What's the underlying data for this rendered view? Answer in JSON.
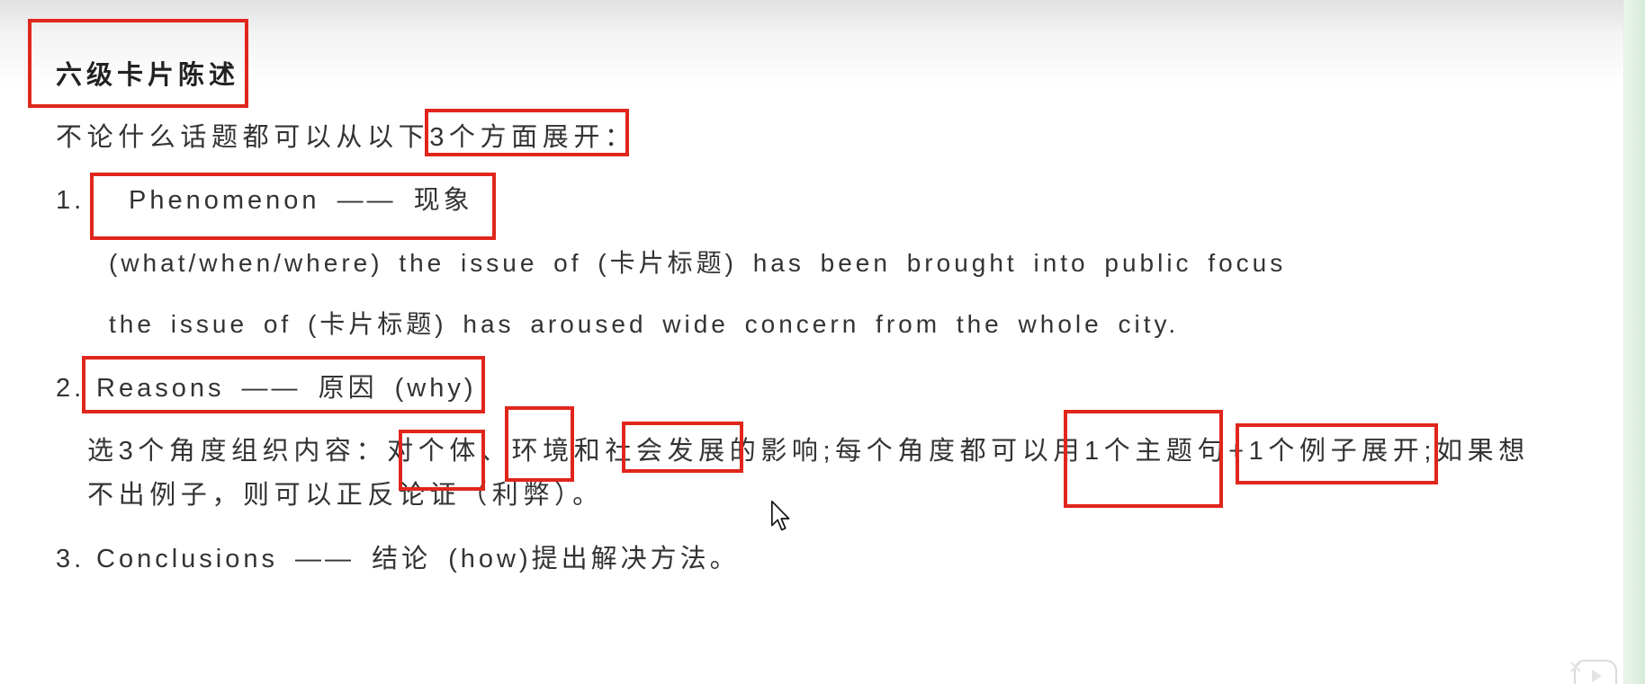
{
  "colors": {
    "background": "#ffffff",
    "text": "#333333",
    "title": "#222222",
    "annotation": "#e0261c",
    "side_strip": "#d6ead8"
  },
  "icons": {
    "cursor": "mouse-cursor-icon",
    "floating_control": "floating-control-icon"
  },
  "document": {
    "title": "六级卡片陈述",
    "intro": "不论什么话题都可以从以下3个方面展开：",
    "sections": [
      {
        "number": "1.",
        "heading": "Phenomenon —— 现象",
        "lines": [
          "(what/when/where) the issue of (卡片标题) has been brought into public focus",
          "the issue of (卡片标题) has aroused wide concern from the whole city."
        ]
      },
      {
        "number": "2.",
        "heading": "Reasons —— 原因 (why)",
        "lines": [
          "选3个角度组织内容：对个体、环境和社会发展的影响;每个角度都可以用1个主题句+1个例子展开;如果想",
          "不出例子，则可以正反论证（利弊）。"
        ]
      },
      {
        "number": "3.",
        "heading": "Conclusions —— 结论 (how)提出解决方法。"
      }
    ]
  }
}
